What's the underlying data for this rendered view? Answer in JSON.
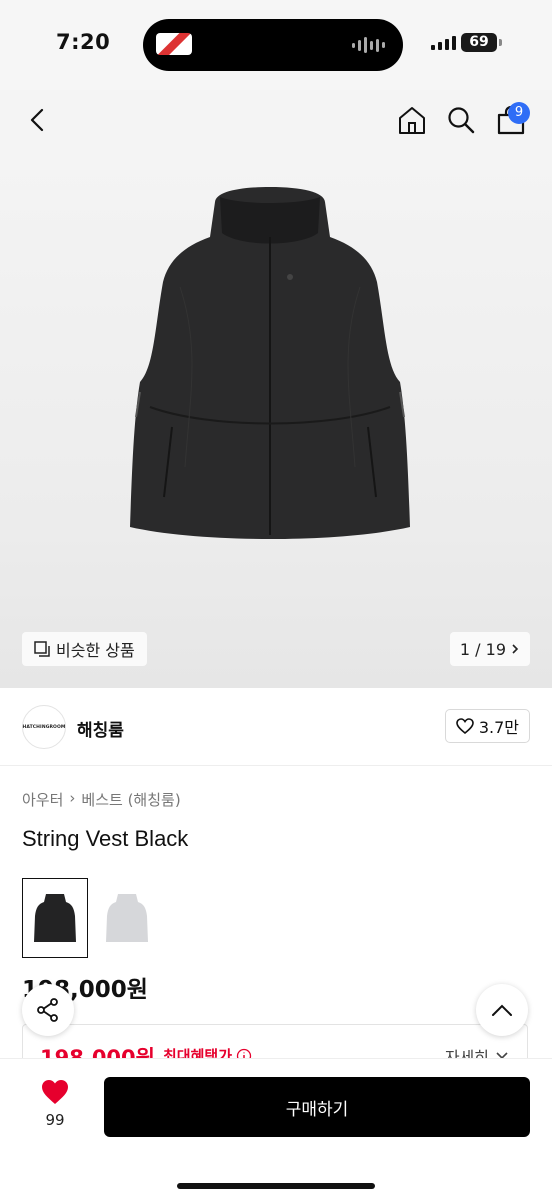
{
  "status": {
    "time": "7:20",
    "battery": "69"
  },
  "nav": {
    "back_icon": "chevron-left-icon",
    "home_icon": "home-icon",
    "search_icon": "search-icon",
    "cart_icon": "bag-icon",
    "cart_badge": "9"
  },
  "hero": {
    "similar_label": "비슷한 상품",
    "page_counter": "1 / 19"
  },
  "brand": {
    "logo_text": "HATCHINGROOM",
    "name": "해칭룸",
    "likes": "3.7만"
  },
  "product": {
    "breadcrumb": [
      "아우터",
      "베스트 (해칭룸)"
    ],
    "title": "String Vest Black",
    "variants": [
      {
        "color": "black",
        "selected": true
      },
      {
        "color": "light gray",
        "selected": false
      }
    ],
    "price": "198,000원"
  },
  "benefit": {
    "price": "198,000원",
    "label": "최대혜택가",
    "detail": "자세히"
  },
  "bottom": {
    "wish_count": "99",
    "buy_label": "구매하기"
  },
  "colors": {
    "accent_red": "#e6002d",
    "badge_blue": "#2f6df6",
    "buy_button": "#000000"
  }
}
